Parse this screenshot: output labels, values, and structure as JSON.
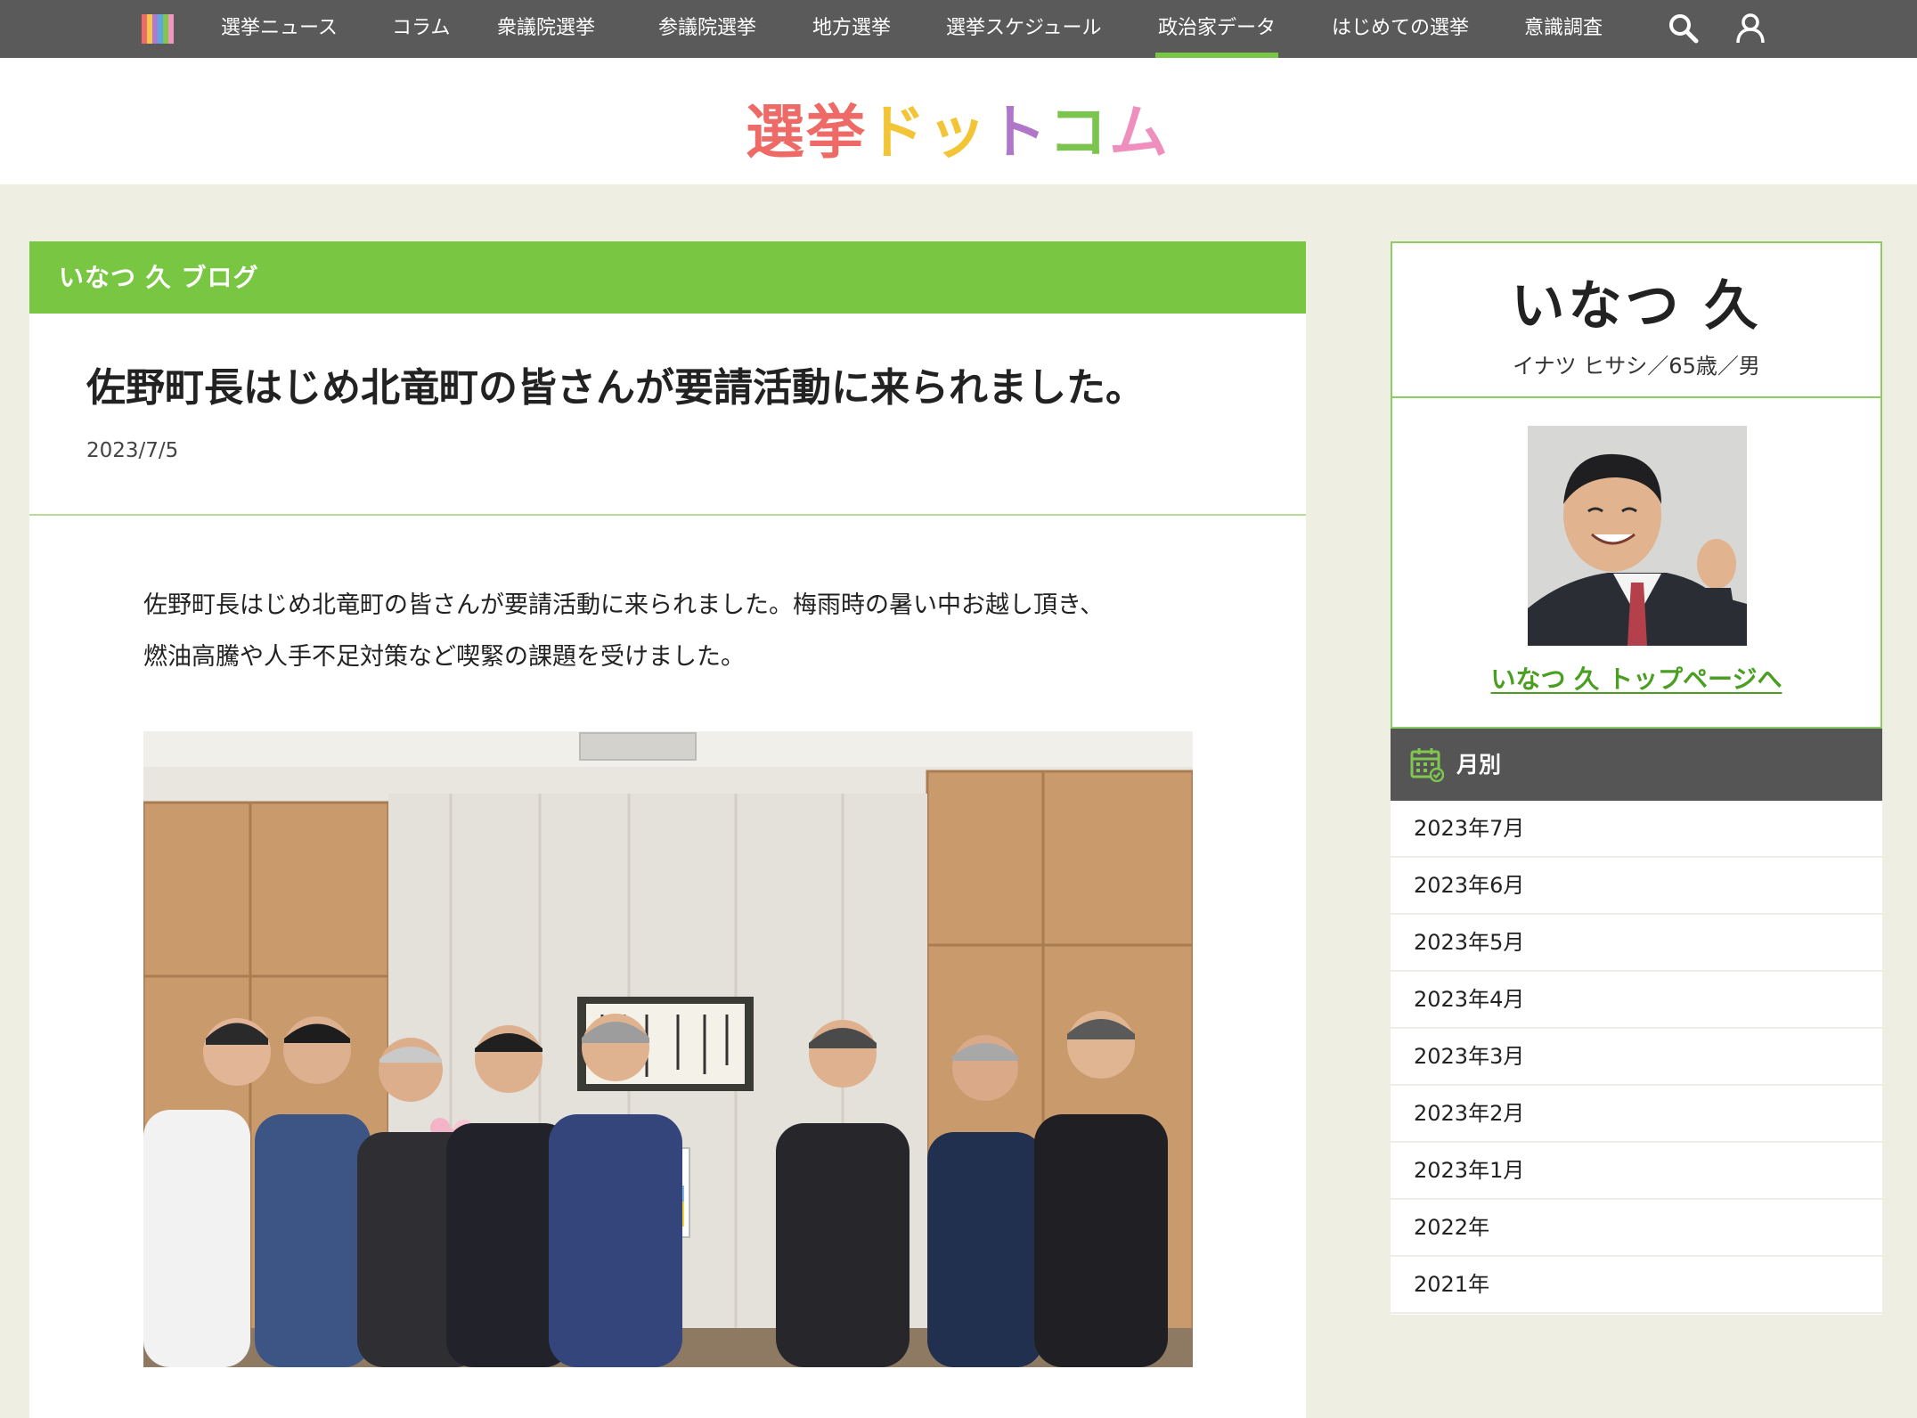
{
  "nav": {
    "items": [
      {
        "label": "選挙ニュース"
      },
      {
        "label": "コラム"
      },
      {
        "label": "衆議院選挙"
      },
      {
        "label": "参議院選挙"
      },
      {
        "label": "地方選挙"
      },
      {
        "label": "選挙スケジュール"
      },
      {
        "label": "政治家データ",
        "active": true
      },
      {
        "label": "はじめての選挙"
      },
      {
        "label": "意識調査"
      }
    ],
    "search_icon": "search-icon",
    "user_icon": "user-icon",
    "logo_colors": [
      "#ef6a6a",
      "#f6c54a",
      "#b07ad0",
      "#5ba7e0",
      "#7fc74e",
      "#ef97c1"
    ]
  },
  "site": {
    "logo_chars": [
      "選",
      "挙",
      "ド",
      "ッ",
      "ト",
      "コ",
      "ム"
    ],
    "logo_colors": [
      "#ee6a66",
      "#ee6a66",
      "#f2c436",
      "#f2c436",
      "#b076c8",
      "#7bc44d",
      "#ee8fbe"
    ]
  },
  "article": {
    "blog_title": "いなつ 久 ブログ",
    "title": "佐野町長はじめ北竜町の皆さんが要請活動に来られました。",
    "date": "2023/7/5",
    "body_line1": "佐野町長はじめ北竜町の皆さんが要請活動に来られました。梅雨時の暑い中お越し頂き、",
    "body_line2": "燃油高騰や人手不足対策など喫緊の課題を受けました。"
  },
  "sidebar": {
    "name": "いなつ 久",
    "kana": "イナツ ヒサシ／65歳／男",
    "top_link": "いなつ 久 トップページへ",
    "month_heading": "月別",
    "calendar_icon": "calendar-icon",
    "months": [
      "2023年7月",
      "2023年6月",
      "2023年5月",
      "2023年4月",
      "2023年3月",
      "2023年2月",
      "2023年1月",
      "2022年",
      "2021年"
    ]
  },
  "colors": {
    "accent_green": "#78c641",
    "nav_bg": "#5a5a5a",
    "page_bg": "#eeeee3"
  }
}
